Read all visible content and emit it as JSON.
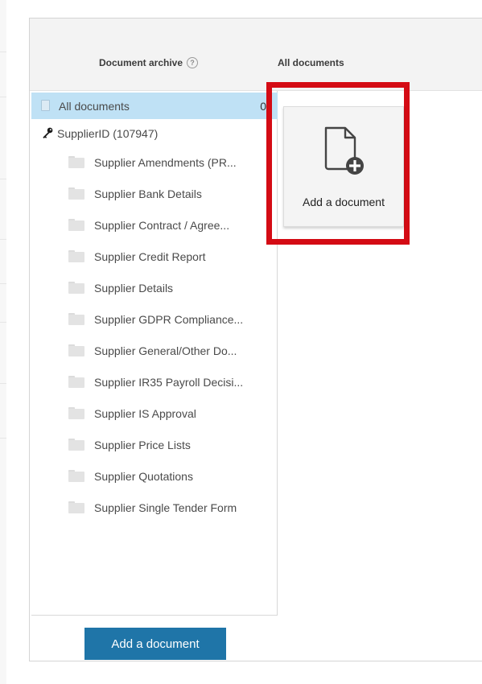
{
  "header": {
    "archive_title": "Document archive",
    "help_glyph": "?",
    "view_title": "All documents"
  },
  "tree": {
    "root": {
      "label": "All documents",
      "count": "0",
      "icon": "document-icon"
    },
    "supplier": {
      "label": "SupplierID (107947)",
      "icon": "key-icon"
    },
    "folders": [
      "Supplier Amendments (PR...",
      "Supplier Bank Details",
      "Supplier Contract / Agree...",
      "Supplier Credit Report",
      "Supplier Details",
      "Supplier GDPR Compliance...",
      "Supplier General/Other Do...",
      "Supplier IR35 Payroll Decisi...",
      "Supplier IS Approval",
      "Supplier Price Lists",
      "Supplier Quotations",
      "Supplier Single Tender Form"
    ]
  },
  "card": {
    "label": "Add a document",
    "icon": "add-document-icon"
  },
  "footer": {
    "add_button_label": "Add a document"
  },
  "colors": {
    "selected_row": "#bfe1f5",
    "primary_button": "#1f75a8",
    "highlight_border": "#d40b14"
  }
}
